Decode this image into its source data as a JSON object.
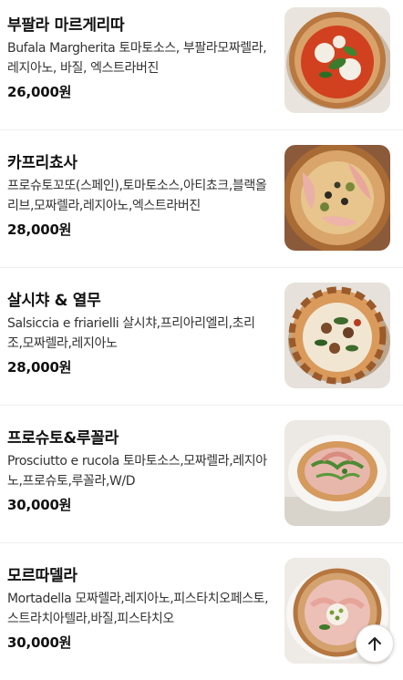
{
  "menu": {
    "items": [
      {
        "name": "부팔라 마르게리따",
        "description": "Bufala Margherita 토마토소스, 부팔라모짜렐라, 레지아노, 바질, 엑스트라버진",
        "price": "26,000원",
        "image": "pizza-margherita-photo"
      },
      {
        "name": "카프리쵸사",
        "description": "프로슈토꼬또(스페인),토마토소스,아티쵸크,블랙올리브,모짜렐라,레지아노,엑스트라버진",
        "price": "28,000원",
        "image": "pizza-capricciosa-photo"
      },
      {
        "name": "살시챠 & 열무",
        "description": "Salsiccia e friarielli 살시챠,프리아리엘리,초리조,모짜렐라,레지아노",
        "price": "28,000원",
        "image": "pizza-salsiccia-photo"
      },
      {
        "name": "프로슈토&루꼴라",
        "description": "Prosciutto e rucola 토마토소스,모짜렐라,레지아노,프로슈토,루꼴라,W/D",
        "price": "30,000원",
        "image": "pizza-prosciutto-photo"
      },
      {
        "name": "모르따델라",
        "description": "Mortadella 모짜렐라,레지아노,피스타치오페스토,스트라치아텔라,바질,피스타치오",
        "price": "30,000원",
        "image": "pizza-mortadella-photo"
      }
    ]
  },
  "scroll_top": {
    "icon": "arrow-up-icon"
  }
}
